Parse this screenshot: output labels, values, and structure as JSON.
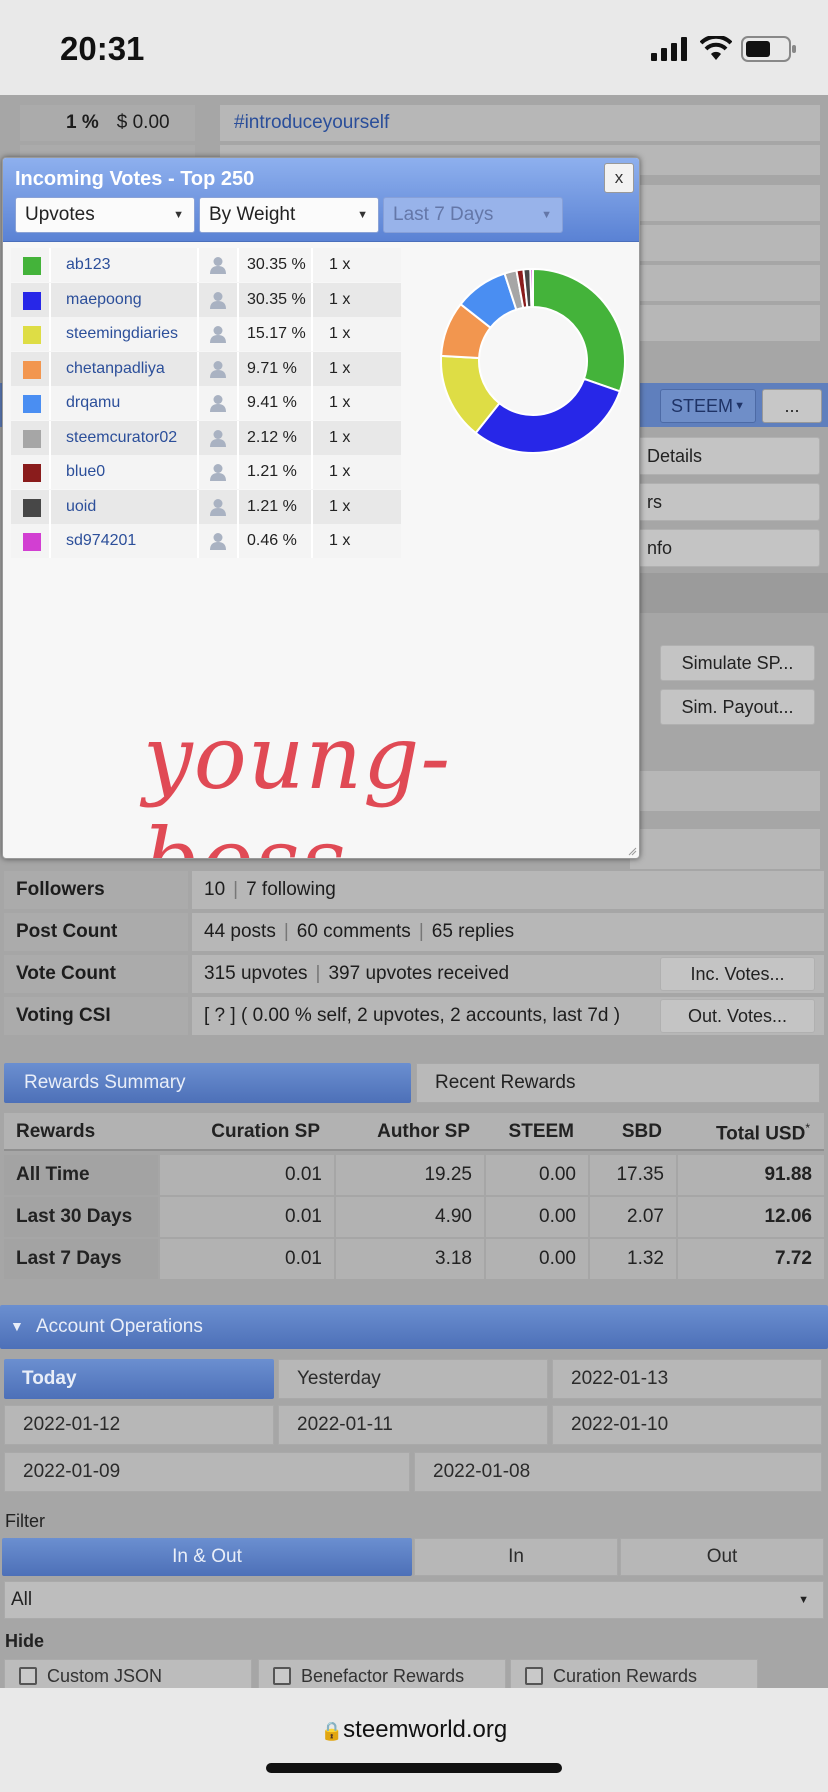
{
  "status_bar": {
    "time": "20:31"
  },
  "background": {
    "top_row": {
      "percent": "1 %",
      "amount": "$ 0.00",
      "tag": "#introduceyourself"
    },
    "currency_select": "STEEM",
    "more_button": "...",
    "menu_fragments": [
      "Details",
      "rs",
      "nfo"
    ],
    "simulate_sp": "Simulate SP...",
    "sim_payout": "Sim. Payout...",
    "stats": [
      {
        "label": "Followers",
        "parts": [
          "10",
          "7 following"
        ]
      },
      {
        "label": "Post Count",
        "parts": [
          "44 posts",
          "60 comments",
          "65 replies"
        ]
      },
      {
        "label": "Vote Count",
        "parts": [
          "315 upvotes",
          "397 upvotes received"
        ],
        "button": "Inc. Votes..."
      },
      {
        "label": "Voting CSI",
        "parts": [
          "[ ? ] ( 0.00 % self, 2 upvotes, 2 accounts, last 7d )"
        ],
        "button": "Out. Votes..."
      }
    ],
    "rewards_tabs": [
      "Rewards Summary",
      "Recent Rewards"
    ],
    "rewards_table": {
      "headers": [
        "Rewards",
        "Curation SP",
        "Author SP",
        "STEEM",
        "SBD",
        "Total USD"
      ],
      "header_note": "*",
      "rows": [
        [
          "All Time",
          "0.01",
          "19.25",
          "0.00",
          "17.35",
          "91.88"
        ],
        [
          "Last 30 Days",
          "0.01",
          "4.90",
          "0.00",
          "2.07",
          "12.06"
        ],
        [
          "Last 7 Days",
          "0.01",
          "3.18",
          "0.00",
          "1.32",
          "7.72"
        ]
      ]
    },
    "account_ops": {
      "title": "Account Operations",
      "dates": [
        "Today",
        "Yesterday",
        "2022-01-13",
        "2022-01-12",
        "2022-01-11",
        "2022-01-10",
        "2022-01-09",
        "2022-01-08"
      ],
      "filter_label": "Filter",
      "filter_tabs": [
        "In & Out",
        "In",
        "Out"
      ],
      "filter_select": "All",
      "hide_label": "Hide",
      "hide_options": [
        "Custom JSON",
        "Benefactor Rewards",
        "Curation Rewards"
      ]
    }
  },
  "modal": {
    "title": "Incoming Votes - Top 250",
    "close": "x",
    "selects": {
      "type": "Upvotes",
      "sort": "By Weight",
      "period": "Last 7 Days"
    },
    "voters": [
      {
        "name": "ab123",
        "pct": "30.35 %",
        "count": "1 x",
        "color": "#44b33a",
        "share": 30.35
      },
      {
        "name": "maepoong",
        "pct": "30.35 %",
        "count": "1 x",
        "color": "#2727e8",
        "share": 30.35
      },
      {
        "name": "steemingdiaries",
        "pct": "15.17 %",
        "count": "1 x",
        "color": "#dedd45",
        "share": 15.17
      },
      {
        "name": "chetanpadliya",
        "pct": "9.71 %",
        "count": "1 x",
        "color": "#f2964f",
        "share": 9.71
      },
      {
        "name": "drqamu",
        "pct": "9.41 %",
        "count": "1 x",
        "color": "#4a8ef2",
        "share": 9.41
      },
      {
        "name": "steemcurator02",
        "pct": "2.12 %",
        "count": "1 x",
        "color": "#a6a6a6",
        "share": 2.12
      },
      {
        "name": "blue0",
        "pct": "1.21 %",
        "count": "1 x",
        "color": "#8a1c1c",
        "share": 1.21
      },
      {
        "name": "uoid",
        "pct": "1.21 %",
        "count": "1 x",
        "color": "#474747",
        "share": 1.21
      },
      {
        "name": "sd974201",
        "pct": "0.46 %",
        "count": "1 x",
        "color": "#d23fd2",
        "share": 0.46
      }
    ],
    "signature": "young-boss"
  },
  "url_bar": {
    "domain": "steemworld.org"
  }
}
